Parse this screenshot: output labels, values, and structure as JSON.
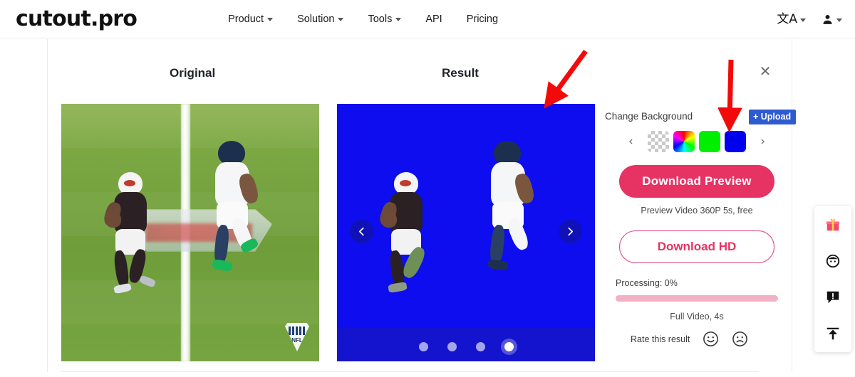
{
  "header": {
    "logo": "cutout.pro",
    "nav": [
      {
        "label": "Product",
        "has_caret": true
      },
      {
        "label": "Solution",
        "has_caret": true
      },
      {
        "label": "Tools",
        "has_caret": true
      },
      {
        "label": "API",
        "has_caret": false
      },
      {
        "label": "Pricing",
        "has_caret": false
      }
    ],
    "language_icon": "文A",
    "account_icon": "person-icon"
  },
  "panels": {
    "original_title": "Original",
    "result_title": "Result",
    "close_label": "✕"
  },
  "original_image": {
    "description": "NFL football video frame, two players on green field",
    "watermark": "NFL"
  },
  "result_image": {
    "description": "Cutout result: two football players on solid blue background",
    "background_color": "#0d0df0",
    "prev_label": "‹",
    "next_label": "›",
    "dots": 4,
    "active_dot": 4
  },
  "controls": {
    "change_background_label": "Change Background",
    "upload_label": "+ Upload",
    "swatch_prev": "‹",
    "swatch_next": "›",
    "swatches": [
      {
        "name": "transparent",
        "color": "transparent",
        "selected": false
      },
      {
        "name": "rainbow",
        "color": "#ff0000",
        "selected": false
      },
      {
        "name": "green",
        "color": "#00ee00",
        "selected": false
      },
      {
        "name": "blue",
        "color": "#0000ee",
        "selected": true
      }
    ],
    "download_preview_label": "Download Preview",
    "preview_caption": "Preview Video 360P 5s, free",
    "download_hd_label": "Download HD",
    "processing_label": "Processing: 0%",
    "progress_percent": 0,
    "full_video_caption": "Full Video, 4s",
    "rate_label": "Rate this result",
    "rate_good_icon": "smiley-face-icon",
    "rate_bad_icon": "frowning-face-icon"
  },
  "annotations": {
    "arrow_color": "#f20a0a",
    "arrow_to_result": "red arrow pointing at result background area",
    "arrow_to_swatch": "red arrow pointing at blue background swatch"
  },
  "float_toolbar": {
    "items": [
      {
        "name": "gift-icon"
      },
      {
        "name": "support-face-icon"
      },
      {
        "name": "feedback-icon"
      },
      {
        "name": "scroll-to-top-icon"
      }
    ]
  },
  "theme": {
    "accent": "#e63363",
    "upload_blue": "#2f5bd0",
    "result_blue": "#0d0df0"
  }
}
